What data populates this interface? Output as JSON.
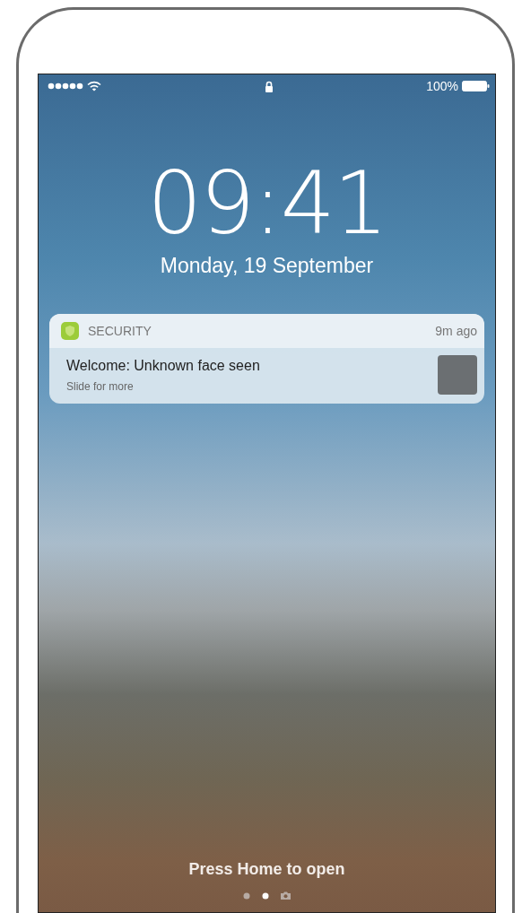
{
  "status_bar": {
    "battery": "100%"
  },
  "clock": {
    "time": "09:41",
    "date": "Monday, 19 September"
  },
  "notification": {
    "app": "SECURITY",
    "time": "9m ago",
    "title": "Welcome: Unknown face seen",
    "subtitle": "Slide for more"
  },
  "unlock_hint": "Press Home to open",
  "pages": [
    {
      "kind": "dot",
      "selected": false
    },
    {
      "kind": "dot",
      "selected": true
    },
    {
      "kind": "camera",
      "selected": false
    }
  ]
}
